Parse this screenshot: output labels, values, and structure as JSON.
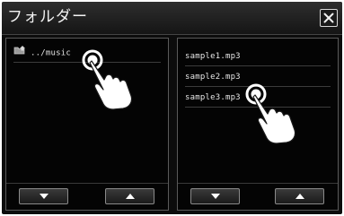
{
  "window": {
    "title": "フォルダー"
  },
  "left_panel": {
    "items": [
      {
        "label": "../music",
        "icon": "folder-up-icon"
      }
    ]
  },
  "right_panel": {
    "items": [
      {
        "label": "sample1.mp3"
      },
      {
        "label": "sample2.mp3"
      },
      {
        "label": "sample3.mp3"
      }
    ]
  },
  "colors": {
    "background": "#0c0c0c",
    "text": "#e6e6e6",
    "panel_border": "#5a5a5a",
    "hand": "#ffffff"
  }
}
